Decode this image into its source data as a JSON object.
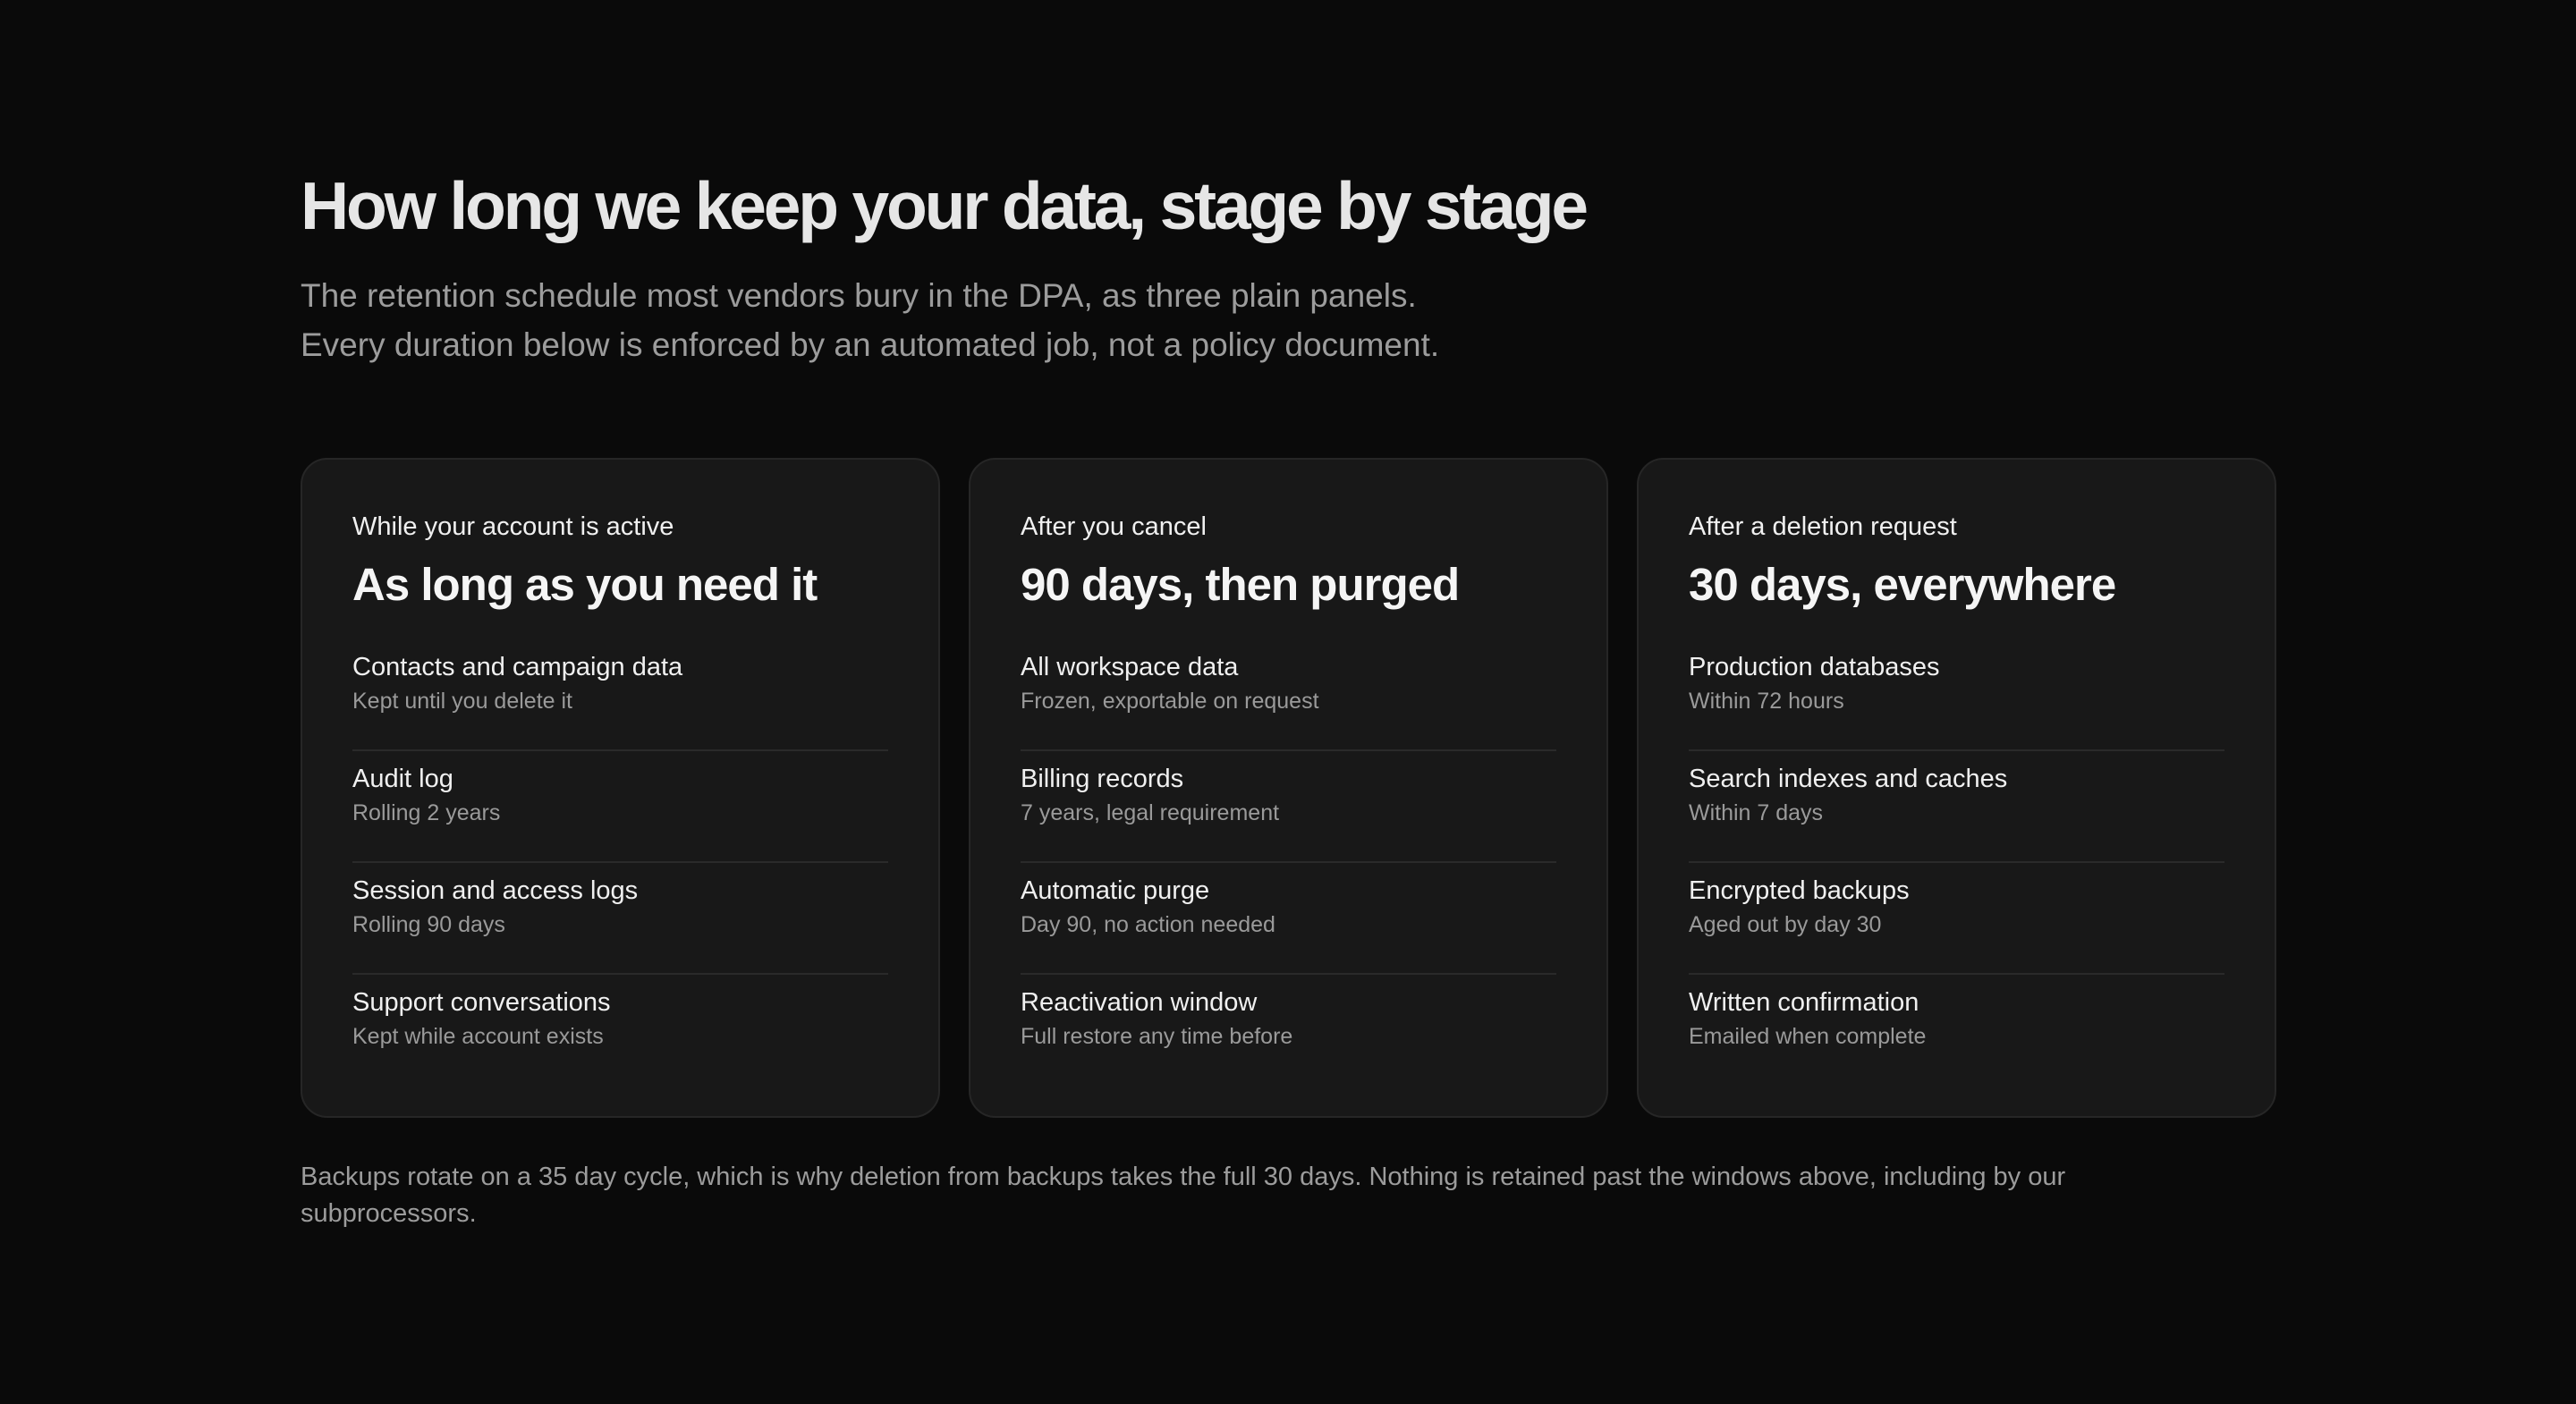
{
  "header": {
    "title": "How long we keep your data, stage by stage",
    "intro_line_1": "The retention schedule most vendors bury in the DPA, as three plain panels.",
    "intro_line_2": "Every duration below is enforced by an automated job, not a policy document."
  },
  "panels": [
    {
      "stage": "While your account is active",
      "headline": "As long as you need it",
      "rows": [
        {
          "title": "Contacts and campaign data",
          "detail": "Kept until you delete it"
        },
        {
          "title": "Audit log",
          "detail": "Rolling 2 years"
        },
        {
          "title": "Session and access logs",
          "detail": "Rolling 90 days"
        },
        {
          "title": "Support conversations",
          "detail": "Kept while account exists"
        }
      ]
    },
    {
      "stage": "After you cancel",
      "headline": "90 days, then purged",
      "rows": [
        {
          "title": "All workspace data",
          "detail": "Frozen, exportable on request"
        },
        {
          "title": "Billing records",
          "detail": "7 years, legal requirement"
        },
        {
          "title": "Automatic purge",
          "detail": "Day 90, no action needed"
        },
        {
          "title": "Reactivation window",
          "detail": "Full restore any time before"
        }
      ]
    },
    {
      "stage": "After a deletion request",
      "headline": "30 days, everywhere",
      "rows": [
        {
          "title": "Production databases",
          "detail": "Within 72 hours"
        },
        {
          "title": "Search indexes and caches",
          "detail": "Within 7 days"
        },
        {
          "title": "Encrypted backups",
          "detail": "Aged out by day 30"
        },
        {
          "title": "Written confirmation",
          "detail": "Emailed when complete"
        }
      ]
    }
  ],
  "footnote": "Backups rotate on a 35 day cycle, which is why deletion from backups takes the full 30 days. Nothing is retained past the windows above, including by our subprocessors."
}
